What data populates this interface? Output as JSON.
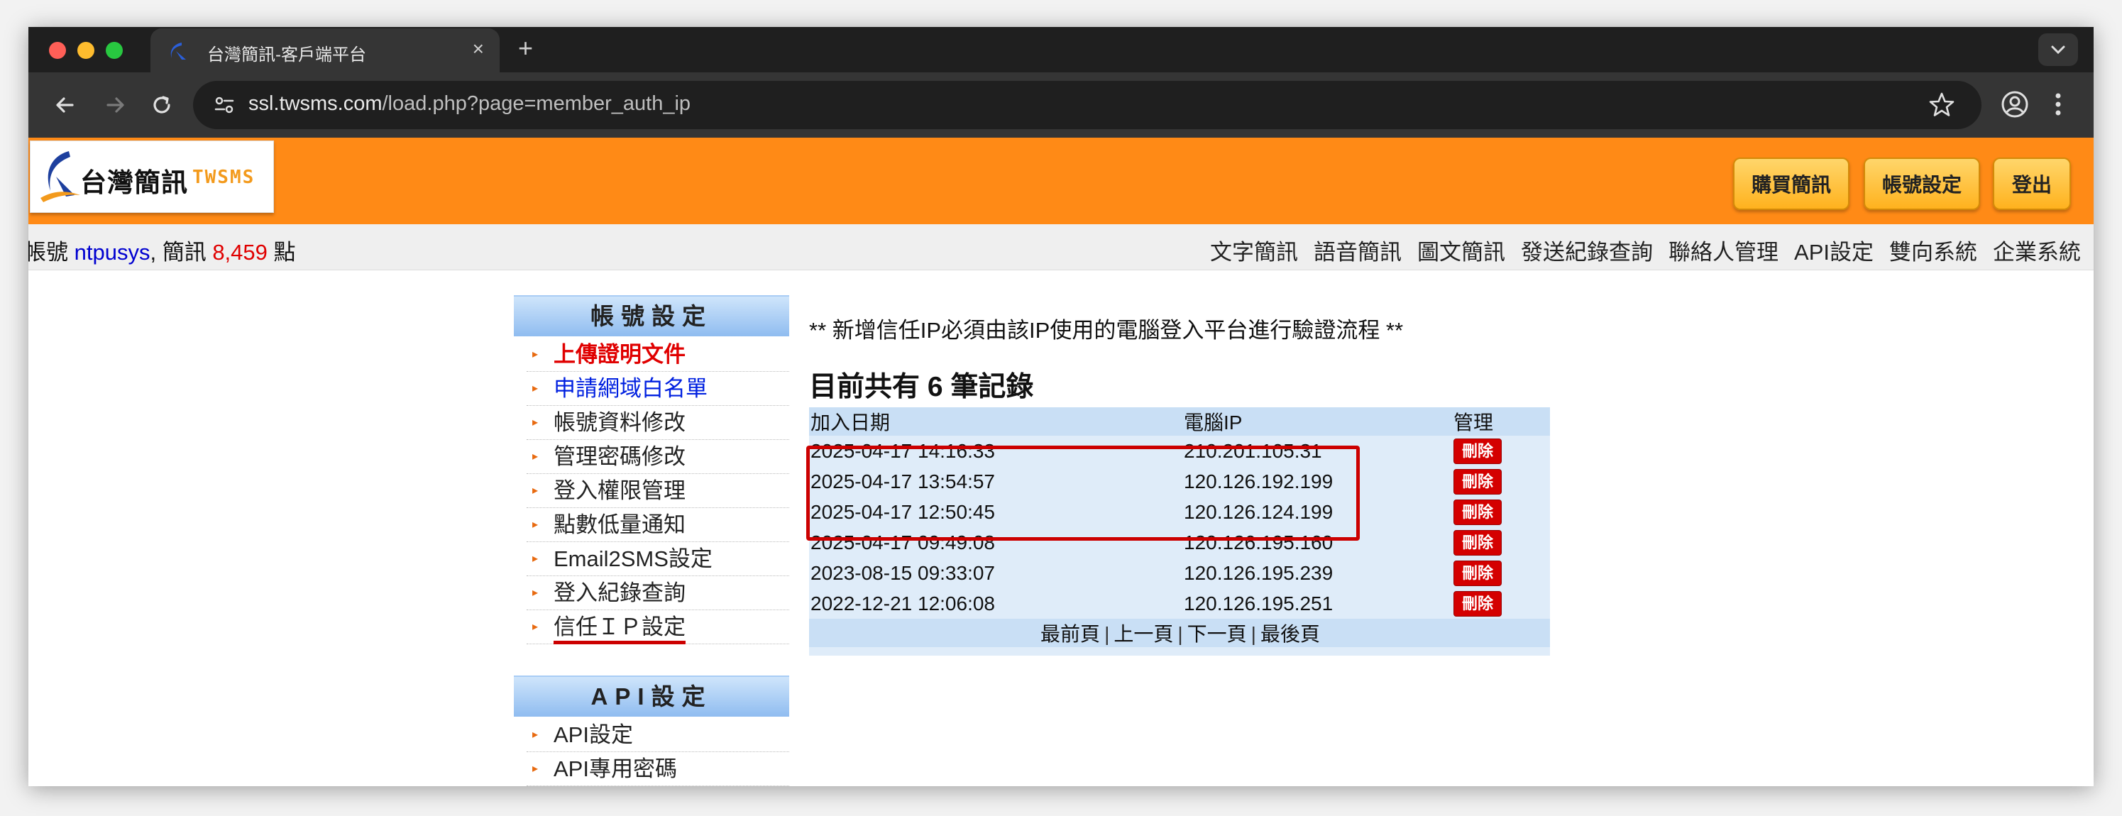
{
  "browser": {
    "tab_title": "台灣簡訊-客戶端平台",
    "tab_close": "×",
    "new_tab": "+",
    "url_host": "ssl.twsms.com",
    "url_path": "/load.php?page=member_auth_ip"
  },
  "header": {
    "logo_cn": "台灣簡訊",
    "logo_en": "TWSMS",
    "buttons": {
      "buy": "購買簡訊",
      "account": "帳號設定",
      "logout": "登出"
    }
  },
  "infobar": {
    "account_prefix": "帳號 ",
    "username": "ntpusys",
    "sms_prefix": ", 簡訊 ",
    "points": "8,459",
    "points_suffix": " 點",
    "nav": [
      "文字簡訊",
      "語音簡訊",
      "圖文簡訊",
      "發送紀錄查詢",
      "聯絡人管理",
      "API設定",
      "雙向系統",
      "企業系統"
    ]
  },
  "sidebar": {
    "account_heading": "帳號設定",
    "account_items": [
      "上傳證明文件",
      "申請網域白名單",
      "帳號資料修改",
      "管理密碼修改",
      "登入權限管理",
      "點數低量通知",
      "Email2SMS設定",
      "登入紀錄查詢",
      "信任ＩＰ設定"
    ],
    "api_heading": "API設定",
    "api_items": [
      "API設定",
      "API專用密碼"
    ]
  },
  "main": {
    "notice": "** 新增信任IP必須由該IP使用的電腦登入平台進行驗證流程 **",
    "count_title": "目前共有 6 筆記錄",
    "headers": {
      "date": "加入日期",
      "ip": "電腦IP",
      "manage": "管理"
    },
    "delete_label": "刪除",
    "rows": [
      {
        "date": "2025-04-17 14:16:33",
        "ip": "210.201.105.31"
      },
      {
        "date": "2025-04-17 13:54:57",
        "ip": "120.126.192.199"
      },
      {
        "date": "2025-04-17 12:50:45",
        "ip": "120.126.124.199"
      },
      {
        "date": "2025-04-17 09:49:08",
        "ip": "120.126.195.160"
      },
      {
        "date": "2023-08-15 09:33:07",
        "ip": "120.126.195.239"
      },
      {
        "date": "2022-12-21 12:06:08",
        "ip": "120.126.195.251"
      }
    ],
    "pager": {
      "first": "最前頁",
      "prev": "上一頁",
      "next": "下一頁",
      "last": "最後頁",
      "sep": "|"
    }
  },
  "colors": {
    "header_orange": "#ff8a16",
    "delete_red": "#d40000",
    "highlight_red": "#cc0000"
  },
  "icons": [
    "back-icon",
    "forward-icon",
    "reload-icon",
    "site-info-icon",
    "star-icon",
    "profile-icon",
    "menu-icon",
    "chevron-down-icon"
  ]
}
